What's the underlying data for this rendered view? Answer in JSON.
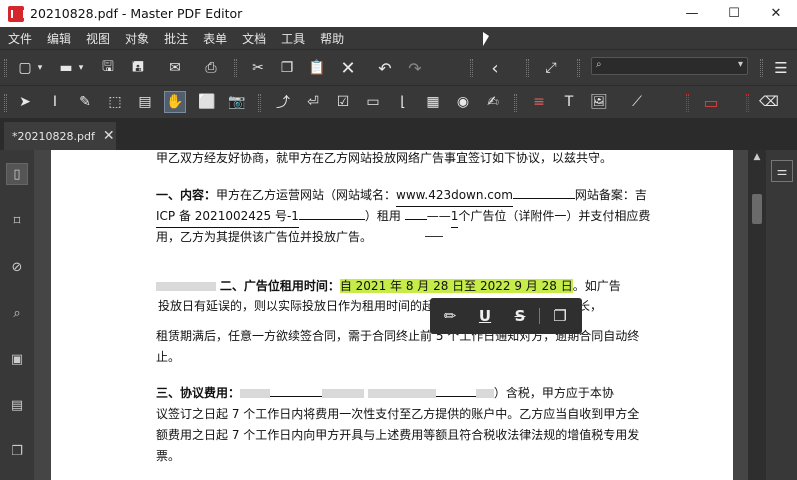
{
  "window": {
    "title": "20210828.pdf - Master PDF Editor",
    "minimize": "—",
    "maximize": "☐",
    "close": "✕"
  },
  "menu": [
    "文件",
    "编辑",
    "视图",
    "对象",
    "批注",
    "表单",
    "文档",
    "工具",
    "帮助"
  ],
  "toolbar1": {
    "search_placeholder": ""
  },
  "tab": {
    "label": "*20210828.pdf"
  },
  "document": {
    "line0": "甲乙双方经友好协商，就甲方在乙方网站投放网络广告事宜签订如下协议，以兹共守。",
    "p1_label": "一、内容：",
    "p1_a": "甲方在乙方运营网站（网站域名：",
    "p1_domain": "www.423down.com",
    "p1_b": "网站备案：吉",
    "p1_c": "ICP 备 2021002425 号-1",
    "p1_d": "）租用",
    "p1_count": "1",
    "p1_e": "个广告位（详附件一）并支付相应费",
    "p1_f": "用，乙方为其提供该广告位并投放广告。",
    "p2_label": "二、广告位租用时间：",
    "p2_from": "自 2021 年 8 月 28 日至 2022 9 月 28 日",
    "p2_tail": "。如广告",
    "p2_b": "投放日有延误的，则以实际投放日作为租用时间的起",
    "p2_b2": "的投放时长，",
    "p2_c": "租赁期满后，任意一方欲续签合同，需于合同终止前 5 个工作日通知对方，逾期合同自动终",
    "p2_d": "止。",
    "p3_label": "三、协议费用：",
    "p3_tail": "）含税，甲方应于本协",
    "p3_b": "议签订之日起 7 个工作日内将费用一次性支付至乙方提供的账户中。乙方应当自收到甲方全",
    "p3_c": "额费用之日起 7 个工作日内向甲方开具与上述费用等额且符合税收法律法规的增值税专用发",
    "p3_d": "票。"
  },
  "popup": {
    "items": [
      "highlight-icon",
      "underline-icon",
      "strikeout-icon",
      "copy-icon"
    ]
  },
  "colors": {
    "highlight": "#c6ec4a",
    "accent_red": "#d4262b"
  }
}
